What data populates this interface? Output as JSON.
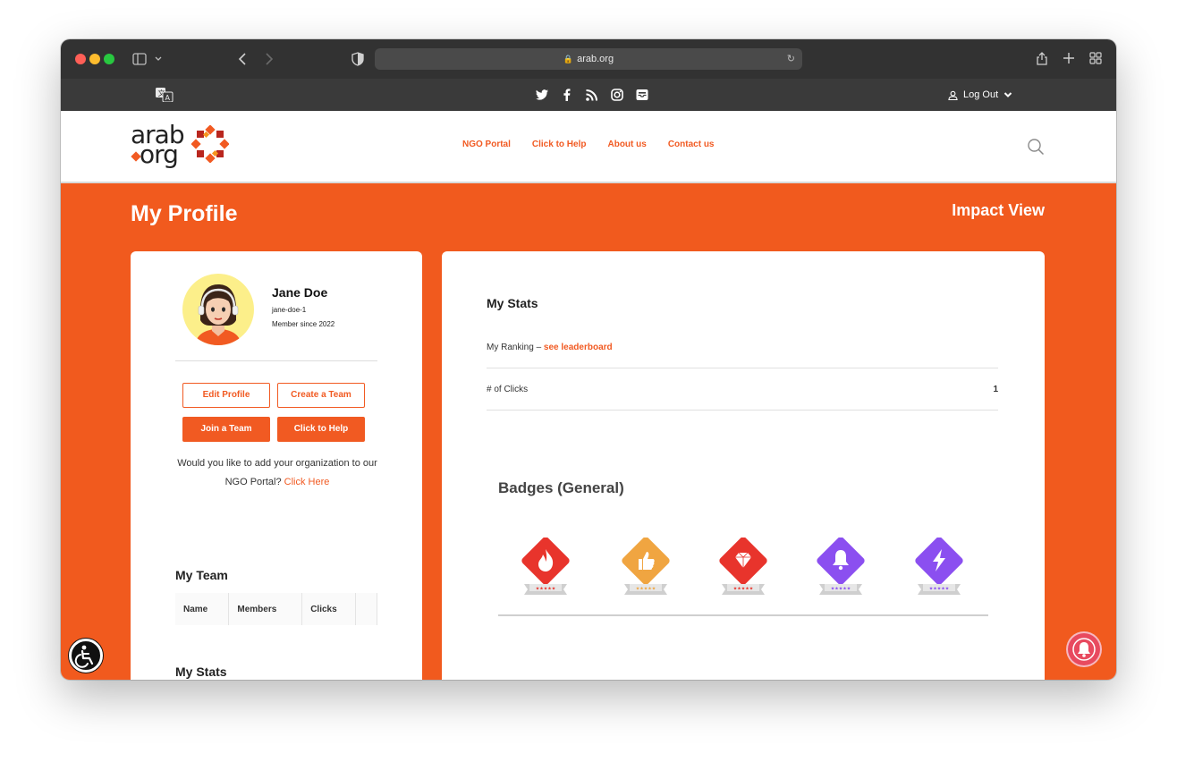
{
  "browser": {
    "url": "arab.org"
  },
  "topbar": {
    "logout_label": "Log Out",
    "social_icons": [
      "twitter-icon",
      "facebook-icon",
      "rss-icon",
      "instagram-icon",
      "newsletter-icon"
    ]
  },
  "logo": {
    "line1": "arab",
    "line2": "org"
  },
  "nav": {
    "items": [
      "NGO Portal",
      "Click to Help",
      "About us",
      "Contact us"
    ]
  },
  "page": {
    "title": "My Profile",
    "impact_view": "Impact View"
  },
  "profile": {
    "name": "Jane Doe",
    "username": "jane-doe-1",
    "member_since": "Member since 2022",
    "buttons": {
      "edit_profile": "Edit Profile",
      "create_team": "Create a Team",
      "join_team": "Join a Team",
      "click_to_help": "Click to Help"
    },
    "ngo_prompt": "Would you like to add your organization to our NGO Portal?",
    "ngo_link": "Click Here"
  },
  "team": {
    "heading": "My Team",
    "columns": [
      "Name",
      "Members",
      "Clicks"
    ]
  },
  "left_stats_heading": "My Stats",
  "stats": {
    "heading": "My Stats",
    "ranking_label": "My Ranking – ",
    "ranking_link": "see leaderboard",
    "clicks_label": "# of Clicks",
    "clicks_value": "1"
  },
  "badges": {
    "heading": "Badges (General)",
    "items": [
      {
        "icon": "flame-badge-icon",
        "color": "#e8342c"
      },
      {
        "icon": "thumbs-up-badge-icon",
        "color": "#f0a541"
      },
      {
        "icon": "diamond-badge-icon",
        "color": "#e8342c"
      },
      {
        "icon": "bell-badge-icon",
        "color": "#8b4ff0"
      },
      {
        "icon": "lightning-badge-icon",
        "color": "#8b4ff0"
      }
    ]
  },
  "colors": {
    "brand_orange": "#f15a22",
    "page_orange": "#f15a1e"
  }
}
